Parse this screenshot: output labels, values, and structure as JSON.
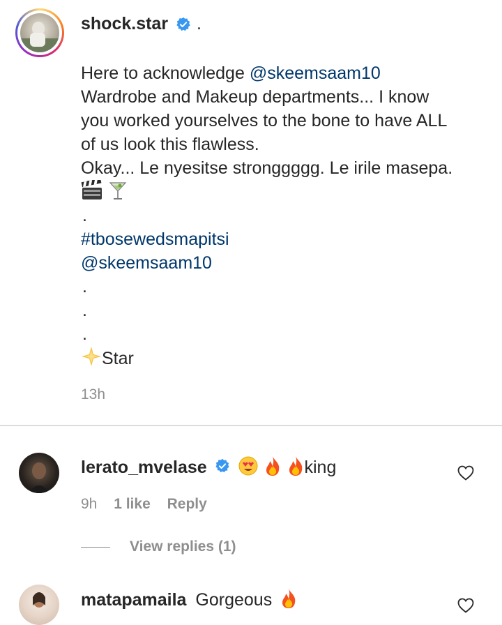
{
  "post": {
    "username": "shock.star",
    "after_badge": ".",
    "caption_lines": [
      "Here to acknowledge ",
      "Wardrobe and Makeup departments... I know",
      "you worked yourselves to the bone to have ALL",
      "of us look this flawless.",
      "Okay... Le nyesitse stronggggg. Le irile masepa."
    ],
    "mention": "@skeemsaam10",
    "dots": ".",
    "hashtag": "#tbosewedsmapitsi",
    "mention2": "@skeemsaam10",
    "signature": "Star",
    "time": "13h"
  },
  "comments": [
    {
      "username": "lerato_mvelase",
      "text": "king",
      "time": "9h",
      "likes": "1 like",
      "reply_label": "Reply",
      "view_replies": "View replies (1)"
    },
    {
      "username": "matapamaila",
      "text": "Gorgeous"
    }
  ],
  "colors": {
    "text": "#262626",
    "link": "#00376b",
    "secondary": "#8e8e8e",
    "verified": "#3897f0",
    "divider": "#dbdbdb"
  },
  "icons": {
    "verified": "verified-badge-icon",
    "heart": "heart-outline-icon",
    "clapper": "clapper-board-icon",
    "cocktail": "cocktail-icon",
    "sparkle": "glowing-star-icon",
    "heart_eyes": "heart-eyes-emoji-icon",
    "fire": "fire-emoji-icon"
  }
}
